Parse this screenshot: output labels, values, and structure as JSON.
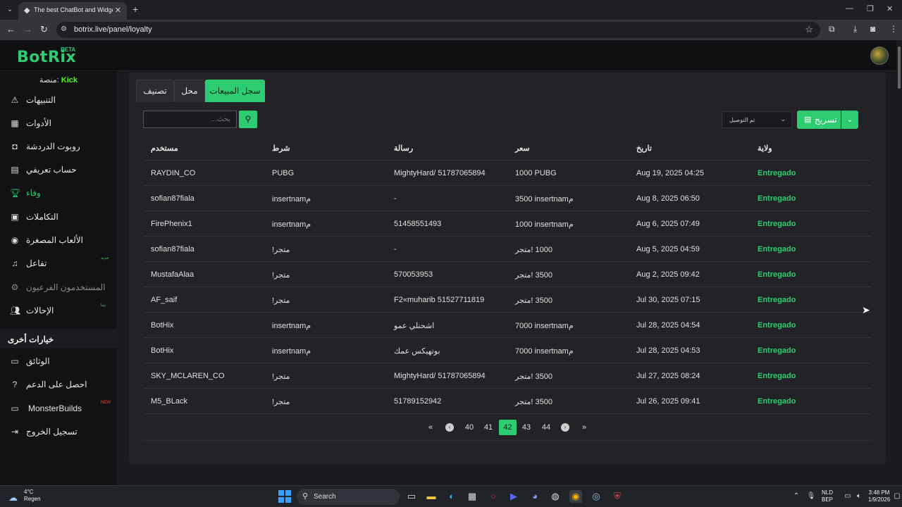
{
  "browser": {
    "tab_title": "The best ChatBot and Widgets",
    "url": "botrix.live/panel/loyalty"
  },
  "app": {
    "logo": "BotRix",
    "beta": "BETA",
    "platform_label": "منصة:",
    "platform_name": "Kick"
  },
  "sidebar": {
    "items": [
      {
        "label": "التنبيهات",
        "icon": "warning-icon"
      },
      {
        "label": "الأدوات",
        "icon": "grid-icon"
      },
      {
        "label": "روبوت الدردشة",
        "icon": "robot-icon"
      },
      {
        "label": "حساب تعريفي",
        "icon": "id-card-icon"
      },
      {
        "label": "وفاء",
        "icon": "trophy-icon"
      },
      {
        "label": "التكاملات",
        "icon": "chat-icon"
      },
      {
        "label": "الألعاب المصغرة",
        "icon": "gamepad-icon"
      },
      {
        "label": "تفاعل",
        "icon": "music-icon",
        "badge": "جديد"
      },
      {
        "label": "المستخدمون الفرعيون",
        "icon": "gear-icon"
      },
      {
        "label": "الإحالات",
        "icon": "users-icon",
        "badge": "بيتا"
      }
    ],
    "section_title": "خيارات أخرى",
    "other_items": [
      {
        "label": "الوثائق",
        "icon": "scroll-icon"
      },
      {
        "label": "احصل على الدعم",
        "icon": "help-icon"
      },
      {
        "label": "MonsterBuilds",
        "icon": "laptop-icon",
        "badge": "NEW"
      },
      {
        "label": "تسجيل الخروج",
        "icon": "logout-icon"
      }
    ]
  },
  "panel": {
    "tabs": [
      "تصنيف",
      "محل",
      "سجل المبيعات"
    ],
    "search_placeholder": "بحث...",
    "status_select": "تم التوصيل",
    "export_label": "تسريح",
    "columns": [
      "مستخدم",
      "شرط",
      "رسالة",
      "سعر",
      "تاريخ",
      "ولاية"
    ],
    "rows": [
      [
        "RAYDIN_CO",
        "PUBG",
        "MightyHard/ 51787065894",
        "1000 PUBG",
        "Aug 19, 2025 04:25",
        "Entregado"
      ],
      [
        "sofian87fiala",
        "insertnamم",
        "-",
        "3500 insertnamم",
        "Aug 8, 2025 06:50",
        "Entregado"
      ],
      [
        "FirePhenix1",
        "insertnamم",
        "51458551493",
        "1000 insertnamم",
        "Aug 6, 2025 07:49",
        "Entregado"
      ],
      [
        "sofian87fiala",
        "متجر!",
        "-",
        "1000 !متجر",
        "Aug 5, 2025 04:59",
        "Entregado"
      ],
      [
        "MustafaAlaa",
        "متجر!",
        "570053953",
        "3500 !متجر",
        "Aug 2, 2025 09:42",
        "Entregado"
      ],
      [
        "AF_saif",
        "متجر!",
        "F2«muharib 51527711819",
        "3500 !متجر",
        "Jul 30, 2025 07:15",
        "Entregado"
      ],
      [
        "BotHix",
        "insertnamم",
        "اشحنلي عمو",
        "7000 insertnamم",
        "Jul 28, 2025 04:54",
        "Entregado"
      ],
      [
        "BotHix",
        "insertnamم",
        "بوتهيكس عمك",
        "7000 insertnamم",
        "Jul 28, 2025 04:53",
        "Entregado"
      ],
      [
        "SKY_MCLAREN_CO",
        "متجر!",
        "MightyHard/ 51787065894",
        "3500 !متجر",
        "Jul 27, 2025 08:24",
        "Entregado"
      ],
      [
        "M5_BLack",
        "متجر!",
        "51789152942",
        "3500 !متجر",
        "Jul 26, 2025 09:41",
        "Entregado"
      ]
    ],
    "pagination": {
      "first": "«",
      "prev": "‹",
      "next": "›",
      "last": "»",
      "pages": [
        "40",
        "41",
        "42",
        "43",
        "44"
      ],
      "current": "42"
    }
  },
  "taskbar": {
    "weather_temp": "4°C",
    "weather_text": "Regen",
    "search": "Search",
    "lang_top": "NLD",
    "lang_bottom": "BEP",
    "time": "3:48 PM",
    "date": "1/9/2026"
  },
  "colors": {
    "accent": "#2ecc71",
    "kick": "#53fc18",
    "background": "#1b1b1f",
    "panel": "#232327"
  }
}
